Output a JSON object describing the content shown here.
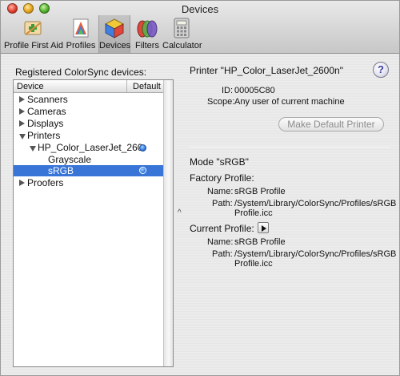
{
  "window": {
    "title": "Devices"
  },
  "toolbar": {
    "items": [
      {
        "label": "Profile First Aid",
        "icon": "first-aid-icon"
      },
      {
        "label": "Profiles",
        "icon": "profiles-icon"
      },
      {
        "label": "Devices",
        "icon": "devices-icon",
        "selected": true
      },
      {
        "label": "Filters",
        "icon": "filters-icon"
      },
      {
        "label": "Calculator",
        "icon": "calculator-icon"
      }
    ]
  },
  "left": {
    "heading": "Registered ColorSync devices:",
    "columns": {
      "device": "Device",
      "default": "Default"
    },
    "rows": [
      {
        "label": "Scanners",
        "expanded": false
      },
      {
        "label": "Cameras",
        "expanded": false
      },
      {
        "label": "Displays",
        "expanded": false
      },
      {
        "label": "Printers",
        "expanded": true
      },
      {
        "label": "HP_Color_LaserJet_260",
        "expanded": true,
        "default": true
      },
      {
        "label": "Grayscale"
      },
      {
        "label": "sRGB",
        "selected": true,
        "default": true
      },
      {
        "label": "Proofers",
        "expanded": false
      }
    ]
  },
  "right": {
    "printer_heading": "Printer \"HP_Color_LaserJet_2600n\"",
    "id_label": "ID:",
    "id_value": "00005C80",
    "scope_label": "Scope:",
    "scope_value": "Any user of current machine",
    "make_default_button": "Make Default Printer",
    "help": "?",
    "mode_heading": "Mode \"sRGB\"",
    "factory_heading": "Factory Profile:",
    "factory_name_label": "Name:",
    "factory_name_value": "sRGB Profile",
    "factory_path_label": "Path:",
    "factory_path_line1": "/System/Library/ColorSync/Profiles/sRGB",
    "factory_path_line2": "Profile.icc",
    "current_heading": "Current Profile:",
    "current_name_label": "Name:",
    "current_name_value": "sRGB Profile",
    "current_path_label": "Path:",
    "current_path_line1": "/System/Library/ColorSync/Profiles/sRGB",
    "current_path_line2": "Profile.icc"
  },
  "colors": {
    "selection": "#3875d7",
    "default_dot": "#2f78e0"
  }
}
